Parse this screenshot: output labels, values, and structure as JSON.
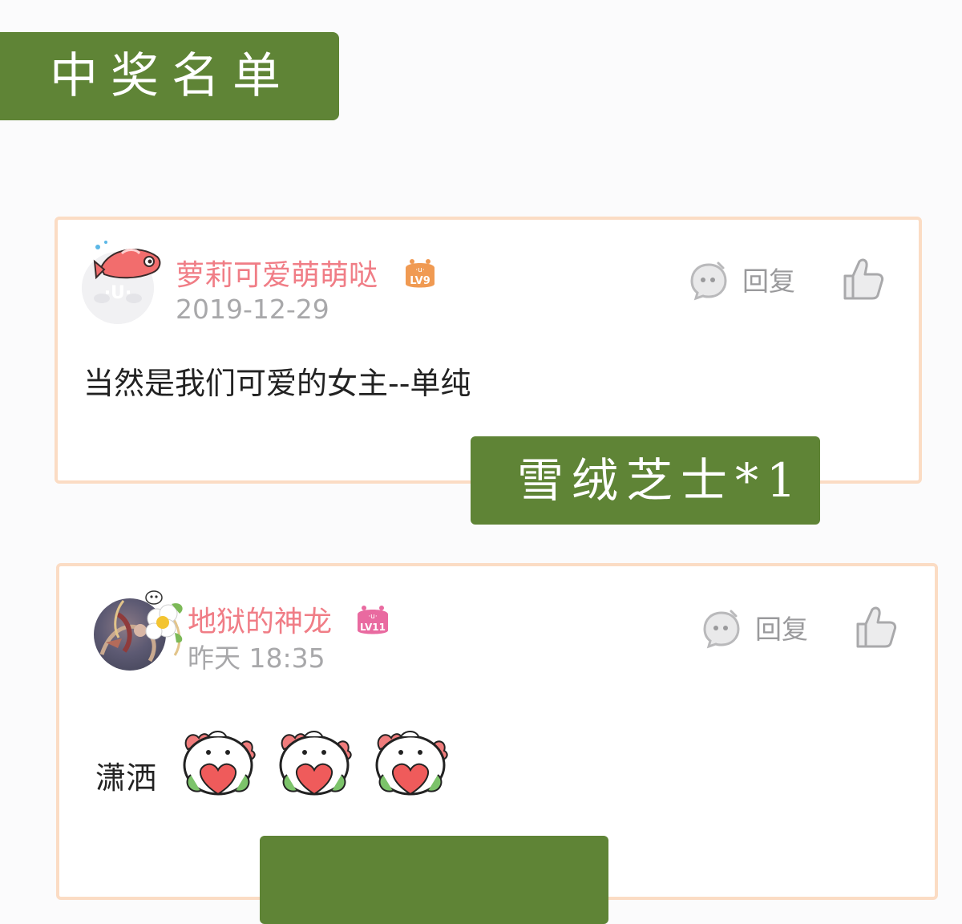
{
  "section_title": "中奖名单",
  "comments": [
    {
      "username": "萝莉可爱萌萌哒",
      "level": "LV9",
      "timestamp": "2019-12-29",
      "reply_label": "回复",
      "text": "当然是我们可爱的女主--单纯",
      "prize": "雪绒芝士*1"
    },
    {
      "username": "地狱的神龙",
      "level": "LV11",
      "timestamp": "昨天 18:35",
      "reply_label": "回复",
      "text": "潇洒",
      "stickers": [
        "heart-bun-sticker",
        "heart-bun-sticker",
        "heart-bun-sticker"
      ],
      "prize": ""
    }
  ],
  "colors": {
    "banner_green": "#5f8436",
    "username_pink": "#f07d86",
    "card_border": "#fbdcc4",
    "level9_orange": "#f09a52",
    "level11_pink": "#e96aa0"
  }
}
